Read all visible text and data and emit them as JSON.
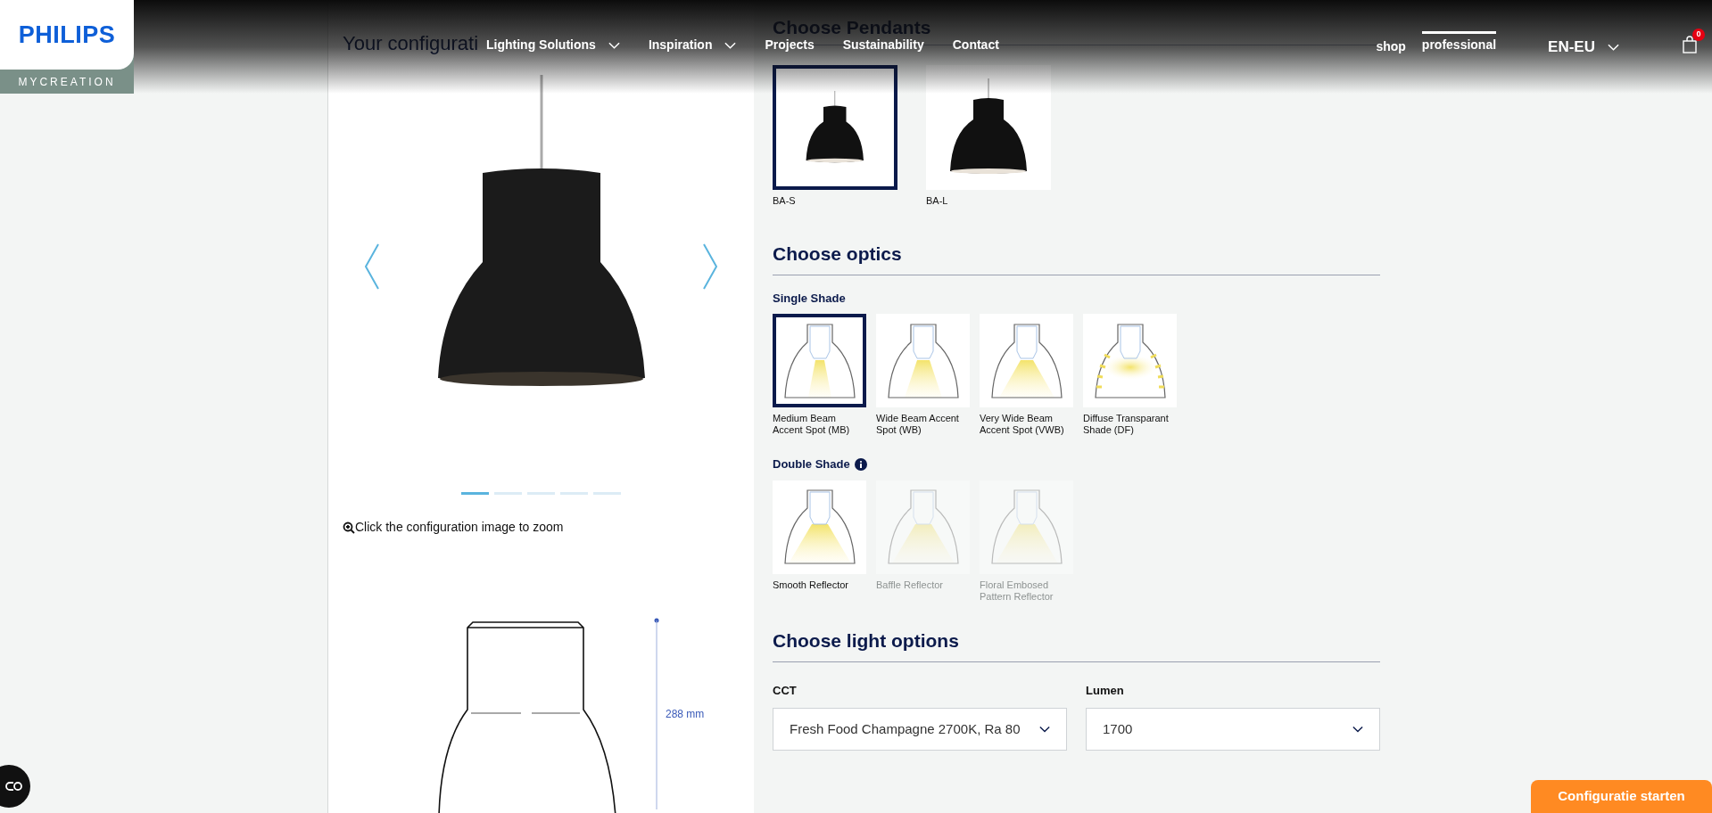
{
  "brand": {
    "name": "PHILIPS",
    "sub": "MYCREATION"
  },
  "nav": [
    {
      "label": "Lighting Solutions",
      "dropdown": true
    },
    {
      "label": "Inspiration",
      "dropdown": true
    },
    {
      "label": "Projects",
      "dropdown": false
    },
    {
      "label": "Sustainability",
      "dropdown": false
    },
    {
      "label": "Contact",
      "dropdown": false
    }
  ],
  "site_switch": [
    {
      "label": "shop",
      "selected": false
    },
    {
      "label": "professional",
      "selected": true
    }
  ],
  "language": "EN-EU",
  "cart": {
    "count": "0"
  },
  "configuration": {
    "title": "Your configurati",
    "slides": [
      {
        "selected": true
      },
      {
        "selected": false
      },
      {
        "selected": false
      },
      {
        "selected": false
      },
      {
        "selected": false
      }
    ],
    "zoom_hint": "Click the configuration image to zoom",
    "dimension": "288 mm"
  },
  "pendants": {
    "title": "Choose Pendants",
    "items": [
      {
        "label": "BA-S",
        "kind": "small",
        "selected": true
      },
      {
        "label": "BA-L",
        "kind": "large",
        "selected": false
      }
    ]
  },
  "optics": {
    "title": "Choose optics",
    "groups": [
      {
        "title": "Single Shade",
        "info": false,
        "items": [
          {
            "label": "Medium Beam Accent Spot (MB)",
            "kind": "medium",
            "selected": true,
            "disabled": false
          },
          {
            "label": "Wide Beam Accent Spot (WB)",
            "kind": "wide",
            "selected": false,
            "disabled": false
          },
          {
            "label": "Very Wide Beam Accent Spot (VWB)",
            "kind": "verywide",
            "selected": false,
            "disabled": false
          },
          {
            "label": "Diffuse Transparant Shade (DF)",
            "kind": "diffuse",
            "selected": false,
            "disabled": false
          }
        ]
      },
      {
        "title": "Double Shade",
        "info": true,
        "items": [
          {
            "label": "Smooth Reflector",
            "kind": "reflector",
            "selected": false,
            "disabled": false
          },
          {
            "label": "Baffle Reflector",
            "kind": "reflector",
            "selected": false,
            "disabled": true
          },
          {
            "label": "Floral Embosed Pattern Reflector",
            "kind": "reflector",
            "selected": false,
            "disabled": true
          }
        ]
      }
    ]
  },
  "light_options": {
    "title": "Choose light options",
    "fields": [
      {
        "label": "CCT",
        "value": "Fresh Food Champagne 2700K, Ra 80"
      },
      {
        "label": "Lumen",
        "value": "1700"
      }
    ]
  },
  "cta": "Configuratie starten"
}
